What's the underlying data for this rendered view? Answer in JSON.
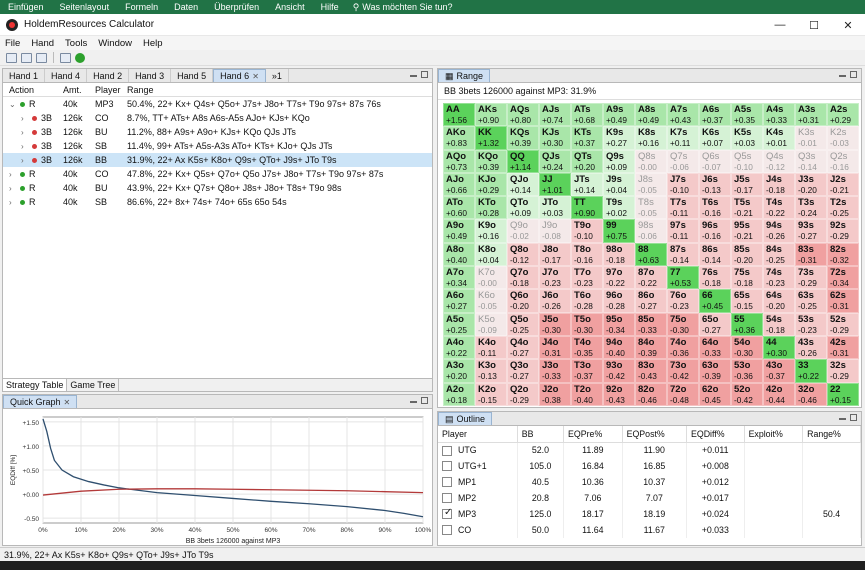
{
  "excel_ribbon": {
    "items": [
      "Einfügen",
      "Seitenlayout",
      "Formeln",
      "Daten",
      "Überprüfen",
      "Ansicht",
      "Hilfe"
    ],
    "search_text": "Was möchten Sie tun?"
  },
  "window": {
    "title": "HoldemResources Calculator",
    "minimize": "—",
    "maximize": "☐",
    "close": "✕"
  },
  "menu": [
    "File",
    "Hand",
    "Tools",
    "Window",
    "Help"
  ],
  "hand_tabs": [
    {
      "label": "Hand 1",
      "active": false
    },
    {
      "label": "Hand 4",
      "active": false
    },
    {
      "label": "Hand 2",
      "active": false
    },
    {
      "label": "Hand 3",
      "active": false
    },
    {
      "label": "Hand 5",
      "active": false
    },
    {
      "label": "Hand 6",
      "active": true
    }
  ],
  "hand_tabs_overflow": "»1",
  "strategy": {
    "headers": {
      "action": "Action",
      "amt": "Amt.",
      "player": "Player",
      "range": "Range"
    },
    "rows": [
      {
        "indent": 0,
        "chev": "⌄",
        "dot": "green",
        "action": "R",
        "amt": "40k",
        "player": "MP3",
        "range": "50.4%, 22+ Kx+ Q4s+ Q5o+ J7s+ J8o+ T7s+ T9o 97s+ 87s 76s",
        "selected": false
      },
      {
        "indent": 1,
        "chev": "›",
        "dot": "red",
        "action": "3B",
        "amt": "126k",
        "player": "CO",
        "range": "8.7%, TT+ ATs+ A8s A6s-A5s AJo+ KJs+ KQo",
        "selected": false
      },
      {
        "indent": 1,
        "chev": "›",
        "dot": "red",
        "action": "3B",
        "amt": "126k",
        "player": "BU",
        "range": "11.2%, 88+ A9s+ A9o+ KJs+ KQo QJs JTs",
        "selected": false
      },
      {
        "indent": 1,
        "chev": "›",
        "dot": "red",
        "action": "3B",
        "amt": "126k",
        "player": "SB",
        "range": "11.4%, 99+ ATs+ A5s-A3s ATo+ KTs+ KJo+ QJs JTs",
        "selected": false
      },
      {
        "indent": 1,
        "chev": "›",
        "dot": "red",
        "action": "3B",
        "amt": "126k",
        "player": "BB",
        "range": "31.9%, 22+ Ax K5s+ K8o+ Q9s+ QTo+ J9s+ JTo T9s",
        "selected": true
      },
      {
        "indent": 0,
        "chev": "›",
        "dot": "green",
        "action": "R",
        "amt": "40k",
        "player": "CO",
        "range": "47.8%, 22+ Kx+ Q5s+ Q7o+ Q5o J7s+ J8o+ T7s+ T9o 97s+ 87s",
        "selected": false
      },
      {
        "indent": 0,
        "chev": "›",
        "dot": "green",
        "action": "R",
        "amt": "40k",
        "player": "BU",
        "range": "43.9%, 22+ Kx+ Q7s+ Q8o+ J8s+ J8o+ T8s+ T9o 98s",
        "selected": false
      },
      {
        "indent": 0,
        "chev": "›",
        "dot": "green",
        "action": "R",
        "amt": "40k",
        "player": "SB",
        "range": "86.6%, 22+ 8x+ 74s+ 74o+ 65s 65o 54s",
        "selected": false
      }
    ],
    "bottom_tabs": [
      {
        "label": "Strategy Table",
        "active": true
      },
      {
        "label": "Game Tree",
        "active": false
      }
    ]
  },
  "quick_graph": {
    "tab_label": "Quick Graph",
    "chart_data": {
      "type": "line",
      "title": "",
      "xlabel": "BB 3bets 126000 against MP3",
      "ylabel": "EQDiff [%]",
      "x_ticks": [
        "0%",
        "10%",
        "20%",
        "30%",
        "40%",
        "50%",
        "60%",
        "70%",
        "80%",
        "90%",
        "100%"
      ],
      "y_ticks": [
        "+1.50",
        "+1.00",
        "+0.50",
        "+0.00",
        "-0.50"
      ],
      "xlim": [
        0,
        100
      ],
      "ylim": [
        -0.6,
        1.6
      ],
      "series": [
        {
          "name": "",
          "color": "#2f4f6f",
          "x": [
            0,
            1,
            2,
            3,
            5,
            8,
            12,
            16,
            20,
            25,
            30,
            40,
            50,
            60,
            70,
            80,
            90,
            95,
            100
          ],
          "y": [
            1.56,
            1.3,
            0.95,
            0.7,
            0.5,
            0.36,
            0.26,
            0.19,
            0.13,
            0.08,
            0.03,
            -0.03,
            -0.09,
            -0.15,
            -0.2,
            -0.26,
            -0.34,
            -0.4,
            -0.47
          ]
        },
        {
          "name": "",
          "color": "#b33a3a",
          "x": [
            0,
            10,
            20,
            30,
            40,
            50,
            60,
            70,
            80,
            90,
            100
          ],
          "y": [
            -0.02,
            0.06,
            0.1,
            0.11,
            0.11,
            0.1,
            0.09,
            0.08,
            0.07,
            0.05,
            0.03
          ]
        }
      ]
    }
  },
  "range_panel": {
    "tab_label": "Range",
    "info": "BB 3bets 126000 against MP3: 31.9%",
    "colors": {
      "strong_green": "#5bd25b",
      "green": "#a9e6a9",
      "light_green": "#d5f2d5",
      "pale": "#f4e9e9",
      "pink": "#f4c9c9",
      "red": "#f0a0a0"
    },
    "grid": [
      [
        [
          "AA",
          "+1.56",
          "g3"
        ],
        [
          "AKs",
          "+0.90",
          "g2"
        ],
        [
          "AQs",
          "+0.80",
          "g2"
        ],
        [
          "AJs",
          "+0.74",
          "g2"
        ],
        [
          "ATs",
          "+0.68",
          "g2"
        ],
        [
          "A9s",
          "+0.49",
          "g2"
        ],
        [
          "A8s",
          "+0.49",
          "g2"
        ],
        [
          "A7s",
          "+0.43",
          "g2"
        ],
        [
          "A6s",
          "+0.37",
          "g2"
        ],
        [
          "A5s",
          "+0.35",
          "g2"
        ],
        [
          "A4s",
          "+0.33",
          "g2"
        ],
        [
          "A3s",
          "+0.31",
          "g2"
        ],
        [
          "A2s",
          "+0.29",
          "g2"
        ]
      ],
      [
        [
          "AKo",
          "+0.83",
          "g2"
        ],
        [
          "KK",
          "+1.32",
          "g3"
        ],
        [
          "KQs",
          "+0.39",
          "g2"
        ],
        [
          "KJs",
          "+0.30",
          "g2"
        ],
        [
          "KTs",
          "+0.37",
          "g2"
        ],
        [
          "K9s",
          "+0.27",
          "g1"
        ],
        [
          "K8s",
          "+0.16",
          "g1"
        ],
        [
          "K7s",
          "+0.11",
          "g1"
        ],
        [
          "K6s",
          "+0.07",
          "g1"
        ],
        [
          "K5s",
          "+0.03",
          "g1"
        ],
        [
          "K4s",
          "+0.01",
          "g1"
        ],
        [
          "K3s",
          "-0.01",
          "pl"
        ],
        [
          "K2s",
          "-0.03",
          "pl"
        ]
      ],
      [
        [
          "AQo",
          "+0.73",
          "g2"
        ],
        [
          "KQo",
          "+0.39",
          "g2"
        ],
        [
          "QQ",
          "+1.14",
          "g3"
        ],
        [
          "QJs",
          "+0.24",
          "g2"
        ],
        [
          "QTs",
          "+0.20",
          "g2"
        ],
        [
          "Q9s",
          "+0.09",
          "g1"
        ],
        [
          "Q8s",
          "-0.00",
          "pl"
        ],
        [
          "Q7s",
          "-0.06",
          "pl"
        ],
        [
          "Q6s",
          "-0.07",
          "pl"
        ],
        [
          "Q5s",
          "-0.10",
          "pl"
        ],
        [
          "Q4s",
          "-0.12",
          "pl"
        ],
        [
          "Q3s",
          "-0.14",
          "pl"
        ],
        [
          "Q2s",
          "-0.16",
          "pl"
        ]
      ],
      [
        [
          "AJo",
          "+0.66",
          "g2"
        ],
        [
          "KJo",
          "+0.29",
          "g2"
        ],
        [
          "QJo",
          "+0.14",
          "g1"
        ],
        [
          "JJ",
          "+1.01",
          "g3"
        ],
        [
          "JTs",
          "+0.14",
          "g1"
        ],
        [
          "J9s",
          "+0.04",
          "g1"
        ],
        [
          "J8s",
          "-0.05",
          "pl"
        ],
        [
          "J7s",
          "-0.10",
          "pk"
        ],
        [
          "J6s",
          "-0.13",
          "pk"
        ],
        [
          "J5s",
          "-0.17",
          "pk"
        ],
        [
          "J4s",
          "-0.18",
          "pk"
        ],
        [
          "J3s",
          "-0.20",
          "pk"
        ],
        [
          "J2s",
          "-0.21",
          "pk"
        ]
      ],
      [
        [
          "ATo",
          "+0.60",
          "g2"
        ],
        [
          "KTo",
          "+0.28",
          "g2"
        ],
        [
          "QTo",
          "+0.09",
          "g1"
        ],
        [
          "JTo",
          "+0.03",
          "g1"
        ],
        [
          "TT",
          "+0.90",
          "g3"
        ],
        [
          "T9s",
          "+0.02",
          "g1"
        ],
        [
          "T8s",
          "-0.05",
          "pl"
        ],
        [
          "T7s",
          "-0.11",
          "pk"
        ],
        [
          "T6s",
          "-0.16",
          "pk"
        ],
        [
          "T5s",
          "-0.21",
          "pk"
        ],
        [
          "T4s",
          "-0.22",
          "pk"
        ],
        [
          "T3s",
          "-0.24",
          "pk"
        ],
        [
          "T2s",
          "-0.25",
          "pk"
        ]
      ],
      [
        [
          "A9o",
          "+0.49",
          "g2"
        ],
        [
          "K9o",
          "+0.16",
          "g1"
        ],
        [
          "Q9o",
          "-0.02",
          "pl"
        ],
        [
          "J9o",
          "-0.08",
          "pl"
        ],
        [
          "T9o",
          "-0.10",
          "pk"
        ],
        [
          "99",
          "+0.75",
          "g3"
        ],
        [
          "98s",
          "-0.06",
          "pl"
        ],
        [
          "97s",
          "-0.11",
          "pk"
        ],
        [
          "96s",
          "-0.16",
          "pk"
        ],
        [
          "95s",
          "-0.21",
          "pk"
        ],
        [
          "94s",
          "-0.26",
          "pk"
        ],
        [
          "93s",
          "-0.27",
          "pk"
        ],
        [
          "92s",
          "-0.29",
          "pk"
        ]
      ],
      [
        [
          "A8o",
          "+0.40",
          "g2"
        ],
        [
          "K8o",
          "+0.04",
          "g1"
        ],
        [
          "Q8o",
          "-0.12",
          "pk"
        ],
        [
          "J8o",
          "-0.17",
          "pk"
        ],
        [
          "T8o",
          "-0.16",
          "pk"
        ],
        [
          "98o",
          "-0.18",
          "pk"
        ],
        [
          "88",
          "+0.63",
          "g3"
        ],
        [
          "87s",
          "-0.14",
          "pk"
        ],
        [
          "86s",
          "-0.14",
          "pk"
        ],
        [
          "85s",
          "-0.20",
          "pk"
        ],
        [
          "84s",
          "-0.25",
          "pk"
        ],
        [
          "83s",
          "-0.31",
          "rd"
        ],
        [
          "82s",
          "-0.32",
          "rd"
        ]
      ],
      [
        [
          "A7o",
          "+0.34",
          "g2"
        ],
        [
          "K7o",
          "-0.00",
          "pl"
        ],
        [
          "Q7o",
          "-0.18",
          "pk"
        ],
        [
          "J7o",
          "-0.23",
          "pk"
        ],
        [
          "T7o",
          "-0.23",
          "pk"
        ],
        [
          "97o",
          "-0.22",
          "pk"
        ],
        [
          "87o",
          "-0.22",
          "pk"
        ],
        [
          "77",
          "+0.53",
          "g3"
        ],
        [
          "76s",
          "-0.18",
          "pk"
        ],
        [
          "75s",
          "-0.18",
          "pk"
        ],
        [
          "74s",
          "-0.23",
          "pk"
        ],
        [
          "73s",
          "-0.29",
          "pk"
        ],
        [
          "72s",
          "-0.34",
          "rd"
        ]
      ],
      [
        [
          "A6o",
          "+0.27",
          "g2"
        ],
        [
          "K6o",
          "-0.05",
          "pl"
        ],
        [
          "Q6o",
          "-0.20",
          "pk"
        ],
        [
          "J6o",
          "-0.26",
          "pk"
        ],
        [
          "T6o",
          "-0.28",
          "pk"
        ],
        [
          "96o",
          "-0.28",
          "pk"
        ],
        [
          "86o",
          "-0.27",
          "pk"
        ],
        [
          "76o",
          "-0.23",
          "pk"
        ],
        [
          "66",
          "+0.45",
          "g3"
        ],
        [
          "65s",
          "-0.15",
          "pk"
        ],
        [
          "64s",
          "-0.20",
          "pk"
        ],
        [
          "63s",
          "-0.25",
          "pk"
        ],
        [
          "62s",
          "-0.31",
          "rd"
        ]
      ],
      [
        [
          "A5o",
          "+0.25",
          "g2"
        ],
        [
          "K5o",
          "-0.09",
          "pl"
        ],
        [
          "Q5o",
          "-0.25",
          "pk"
        ],
        [
          "J5o",
          "-0.30",
          "rd"
        ],
        [
          "T5o",
          "-0.30",
          "rd"
        ],
        [
          "95o",
          "-0.34",
          "rd"
        ],
        [
          "85o",
          "-0.33",
          "rd"
        ],
        [
          "75o",
          "-0.30",
          "rd"
        ],
        [
          "65o",
          "-0.27",
          "pk"
        ],
        [
          "55",
          "+0.36",
          "g3"
        ],
        [
          "54s",
          "-0.18",
          "pk"
        ],
        [
          "53s",
          "-0.23",
          "pk"
        ],
        [
          "52s",
          "-0.29",
          "pk"
        ]
      ],
      [
        [
          "A4o",
          "+0.22",
          "g2"
        ],
        [
          "K4o",
          "-0.11",
          "pk"
        ],
        [
          "Q4o",
          "-0.27",
          "pk"
        ],
        [
          "J4o",
          "-0.31",
          "rd"
        ],
        [
          "T4o",
          "-0.35",
          "rd"
        ],
        [
          "94o",
          "-0.40",
          "rd"
        ],
        [
          "84o",
          "-0.39",
          "rd"
        ],
        [
          "74o",
          "-0.36",
          "rd"
        ],
        [
          "64o",
          "-0.33",
          "rd"
        ],
        [
          "54o",
          "-0.30",
          "rd"
        ],
        [
          "44",
          "+0.30",
          "g3"
        ],
        [
          "43s",
          "-0.26",
          "pk"
        ],
        [
          "42s",
          "-0.31",
          "rd"
        ]
      ],
      [
        [
          "A3o",
          "+0.20",
          "g2"
        ],
        [
          "K3o",
          "-0.13",
          "pk"
        ],
        [
          "Q3o",
          "-0.27",
          "pk"
        ],
        [
          "J3o",
          "-0.33",
          "rd"
        ],
        [
          "T3o",
          "-0.37",
          "rd"
        ],
        [
          "93o",
          "-0.42",
          "rd"
        ],
        [
          "83o",
          "-0.43",
          "rd"
        ],
        [
          "73o",
          "-0.42",
          "rd"
        ],
        [
          "63o",
          "-0.39",
          "rd"
        ],
        [
          "53o",
          "-0.36",
          "rd"
        ],
        [
          "43o",
          "-0.37",
          "rd"
        ],
        [
          "33",
          "+0.22",
          "g3"
        ],
        [
          "32s",
          "-0.29",
          "pk"
        ]
      ],
      [
        [
          "A2o",
          "+0.18",
          "g2"
        ],
        [
          "K2o",
          "-0.15",
          "pk"
        ],
        [
          "Q2o",
          "-0.29",
          "pk"
        ],
        [
          "J2o",
          "-0.38",
          "rd"
        ],
        [
          "T2o",
          "-0.40",
          "rd"
        ],
        [
          "92o",
          "-0.43",
          "rd"
        ],
        [
          "82o",
          "-0.46",
          "rd"
        ],
        [
          "72o",
          "-0.48",
          "rd"
        ],
        [
          "62o",
          "-0.45",
          "rd"
        ],
        [
          "52o",
          "-0.42",
          "rd"
        ],
        [
          "42o",
          "-0.44",
          "rd"
        ],
        [
          "32o",
          "-0.46",
          "rd"
        ],
        [
          "22",
          "+0.15",
          "g3"
        ]
      ]
    ]
  },
  "outline": {
    "tab_label": "Outline",
    "headers": [
      "Player",
      "BB",
      "EQPre%",
      "EQPost%",
      "EQDiff%",
      "Exploit%",
      "Range%"
    ],
    "rows": [
      {
        "checked": false,
        "player": "UTG",
        "bb": "52.0",
        "eqpre": "11.89",
        "eqpost": "11.90",
        "eqdiff": "+0.011",
        "exploit": "",
        "range": ""
      },
      {
        "checked": false,
        "player": "UTG+1",
        "bb": "105.0",
        "eqpre": "16.84",
        "eqpost": "16.85",
        "eqdiff": "+0.008",
        "exploit": "",
        "range": ""
      },
      {
        "checked": false,
        "player": "MP1",
        "bb": "40.5",
        "eqpre": "10.36",
        "eqpost": "10.37",
        "eqdiff": "+0.012",
        "exploit": "",
        "range": ""
      },
      {
        "checked": false,
        "player": "MP2",
        "bb": "20.8",
        "eqpre": "7.06",
        "eqpost": "7.07",
        "eqdiff": "+0.017",
        "exploit": "",
        "range": ""
      },
      {
        "checked": true,
        "player": "MP3",
        "bb": "125.0",
        "eqpre": "18.17",
        "eqpost": "18.19",
        "eqdiff": "+0.024",
        "exploit": "",
        "range": "50.4"
      },
      {
        "checked": false,
        "player": "CO",
        "bb": "50.0",
        "eqpre": "11.64",
        "eqpost": "11.67",
        "eqdiff": "+0.033",
        "exploit": "",
        "range": ""
      }
    ]
  },
  "status": "31.9%, 22+ Ax K5s+ K8o+ Q9s+ QTo+ J9s+ JTo T9s"
}
